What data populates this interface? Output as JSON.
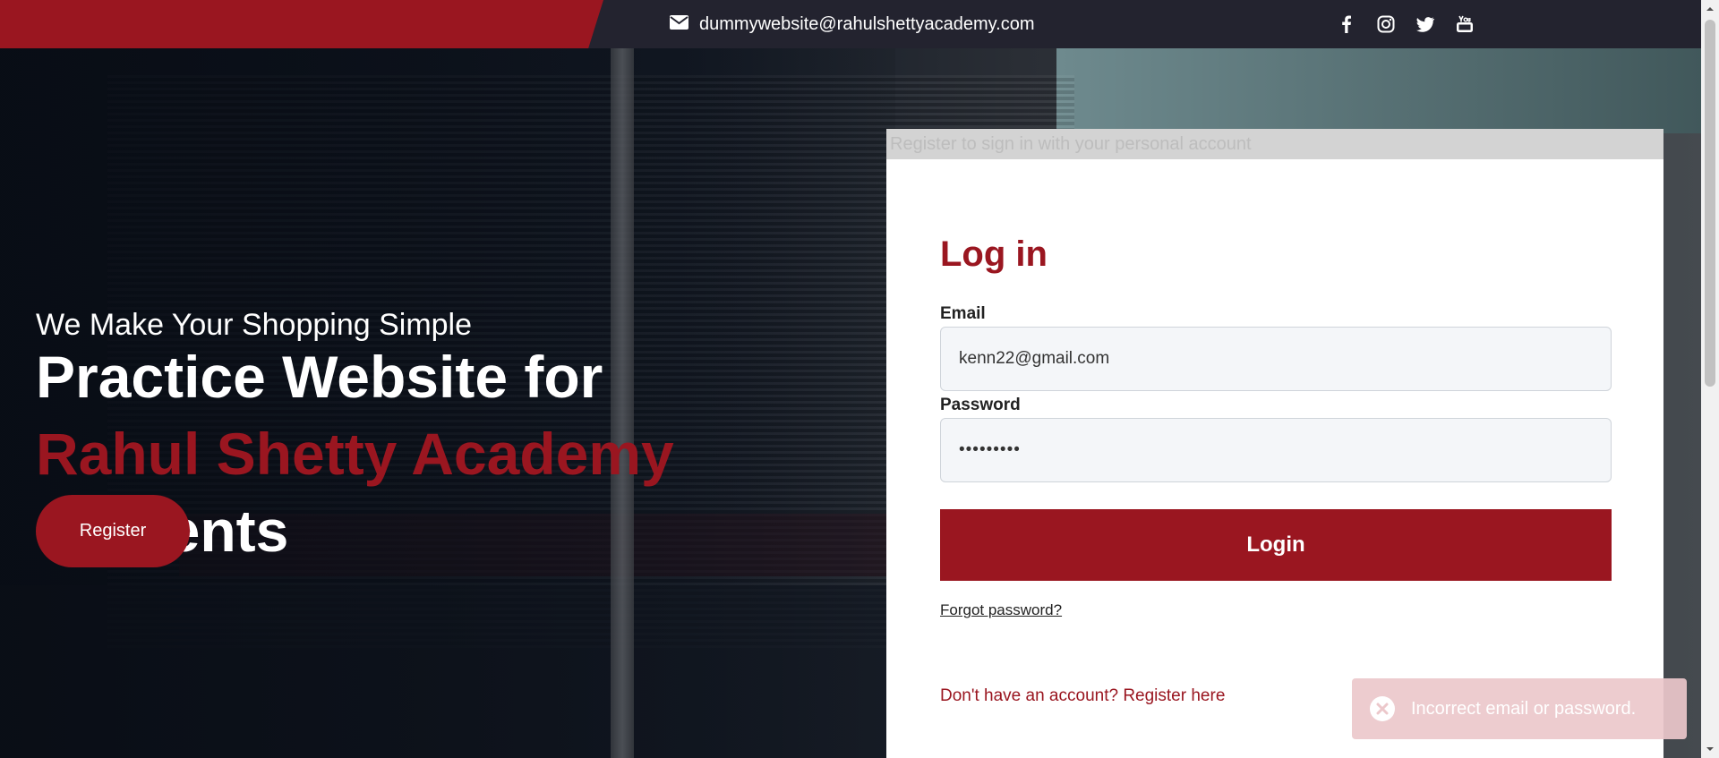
{
  "topbar": {
    "email": "dummywebsite@rahulshettyacademy.com",
    "socials": [
      "facebook",
      "instagram",
      "twitter",
      "youtube"
    ]
  },
  "hero": {
    "tagline": "We Make Your Shopping Simple",
    "headline_part1": "Practice Website for ",
    "headline_accent": "Rahul Shetty Academy",
    "headline_part2": " Students",
    "register_label": "Register"
  },
  "login": {
    "banner": "Register to sign in with your personal account",
    "title": "Log in",
    "email_label": "Email",
    "email_value": "kenn22@gmail.com",
    "password_label": "Password",
    "password_value": "•••••••••",
    "login_label": "Login",
    "forgot_label": "Forgot password?",
    "signup_label": "Don't have an account? Register here"
  },
  "toast": {
    "message": "Incorrect email or password."
  },
  "colors": {
    "brand": "#9a1620",
    "topbar": "#23232f",
    "toast": "#ecc8cb"
  }
}
